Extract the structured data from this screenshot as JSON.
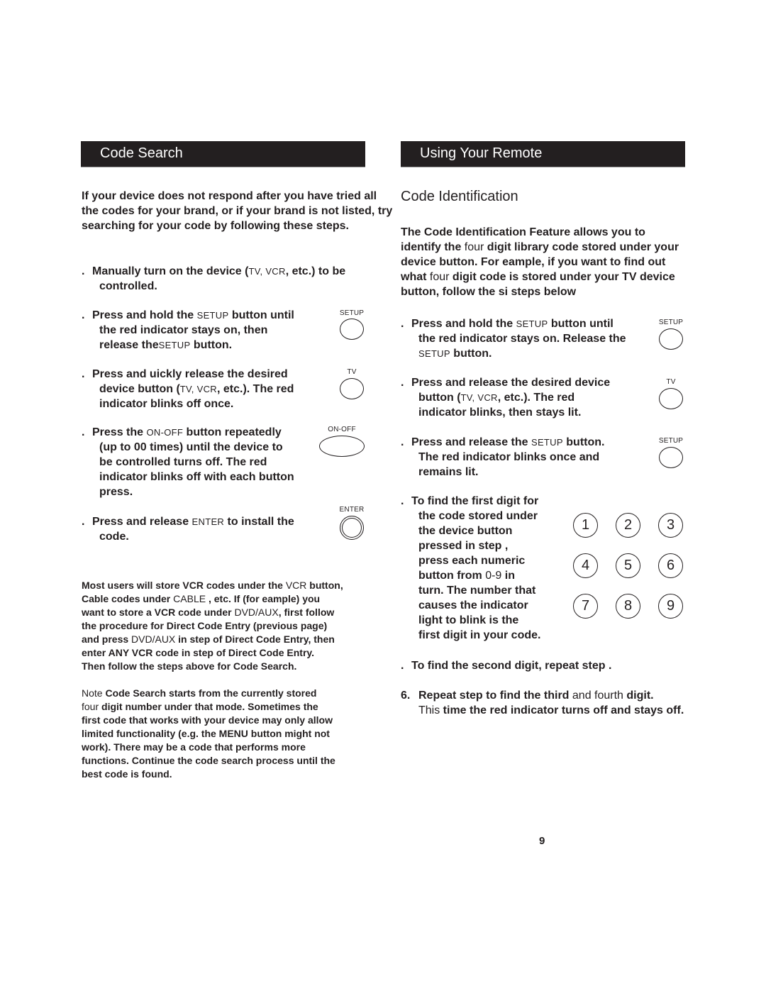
{
  "left": {
    "header": "Code Search",
    "intro": "If your device does not respond after you have tried all the codes for your brand, or if your brand is not listed, try searching for your code by following these steps.",
    "steps": [
      {
        "num": ".",
        "line1_a": "Manually turn on the device (",
        "line1_b": "TV, VCR",
        "line1_c": ", etc.) to be",
        "line2": "controlled."
      },
      {
        "num": ".",
        "line1_a": "Press and hold the ",
        "line1_b": "SETUP",
        "line1_c": " button until",
        "line2": "the red indicator stays on, then",
        "line3_a": "release the",
        "line3_b": "SETUP",
        "line3_c": " button.",
        "icon_label": "SETUP"
      },
      {
        "num": ".",
        "line1": "Press and  uickly  release the desired",
        "line2_a": "device button (",
        "line2_b": "TV, VCR",
        "line2_c": ", etc.). The red",
        "line3": "indicator blinks off once.",
        "icon_label": "TV"
      },
      {
        "num": ".",
        "line1_a": "Press the  ",
        "line1_b": "ON-OFF",
        "line1_c": " button repeatedly",
        "line2": "(up to 00 times) until the device to",
        "line3": "be controlled turns off. The red",
        "line4": "indicator blinks off with each button",
        "line5": "press.",
        "icon_label": "ON-OFF"
      },
      {
        "num": ".",
        "line1_a": "Press and release  ",
        "line1_b": "ENTER",
        "line1_c": " to install the",
        "line2": "code.",
        "icon_label": "ENTER"
      }
    ],
    "para": {
      "l1_a": "Most users will store VCR codes under the ",
      "l1_b": "VCR",
      "l1_c": " button,",
      "l2_a": "Cable codes under ",
      "l2_b": "CABLE",
      "l2_c": " , etc. If (for eample) you",
      "l3_a": "want to store a VCR code under ",
      "l3_b": "DVD/AUX",
      "l3_c": ", first follow",
      "l4": "the procedure for Direct Code Entry (previous page)",
      "l5_a": "and press ",
      "l5_b": "DVD/AUX",
      "l5_c": " in step  of Direct Code Entry, then",
      "l6": "enter ANY VCR code in step  of Direct Code Entry.",
      "l7": "Then follow the steps above for Code Search."
    },
    "note": {
      "l1_a": "Note  ",
      "l1_b": " Code Search starts from the currently stored",
      "l2_a": "four",
      "l2_b": " digit number under that mode. Sometimes the",
      "l3": "first code that works with your device may only allow",
      "l4": "limited functionality (e.g. the MENU button might not",
      "l5": "work). There may be a code that performs more",
      "l6": "functions. Continue the code search process until the",
      "l7": "best code is found."
    }
  },
  "right": {
    "header": "Using Your Remote",
    "subheading": "Code Identification",
    "intro": {
      "l1": "The Code Identification Feature allows you to",
      "l2_a": "identify the ",
      "l2_b": "four",
      "l2_c": " digit library code stored under your",
      "l3": "device button. For eample, if you want to find out",
      "l4_a": "what ",
      "l4_b": "four",
      "l4_c": " digit code is stored under your TV device",
      "l5": "button, follow the si steps below"
    },
    "steps": [
      {
        "num": ".",
        "line1_a": "Press and hold the ",
        "line1_b": "SETUP",
        "line1_c": " button until",
        "line2": "the red indicator stays on. Release the",
        "line3_a": "SETUP",
        "line3_b": " button.",
        "icon_label": "SETUP"
      },
      {
        "num": ".",
        "line1": "Press and release the desired device",
        "line2_a": "button (",
        "line2_b": "TV, VCR",
        "line2_c": ", etc.). The red",
        "line3": "indicator blinks, then stays lit.",
        "icon_label": "TV"
      },
      {
        "num": ".",
        "line1_a": "Press and release the ",
        "line1_b": "SETUP",
        "line1_c": " button.",
        "line2": " The red indicator blinks once and",
        "line3": "remains lit.",
        "icon_label": "SETUP"
      },
      {
        "num": ".",
        "lines": [
          "To find the first digit for",
          "the code stored under",
          "the device button",
          "pressed in step ,",
          "press each numeric"
        ],
        "line6_a": "button from ",
        "line6_b": "0-9",
        "line6_c": " in",
        "lines2": [
          "turn. The number that",
          "causes the indicator",
          "light to blink is the",
          "first digit in your code."
        ]
      },
      {
        "num": ".",
        "line1": "To find the second digit, repeat step ."
      },
      {
        "num": "6.",
        "line1_a": "Repeat step  to find the third",
        "line1_b": " and fourth ",
        "line1_c": " digit.",
        "line2_a": "This",
        "line2_b": " time the red indicator turns off and stays off."
      }
    ],
    "keypad": [
      "1",
      "2",
      "3",
      "4",
      "5",
      "6",
      "7",
      "8",
      "9"
    ]
  },
  "page_number": "9"
}
